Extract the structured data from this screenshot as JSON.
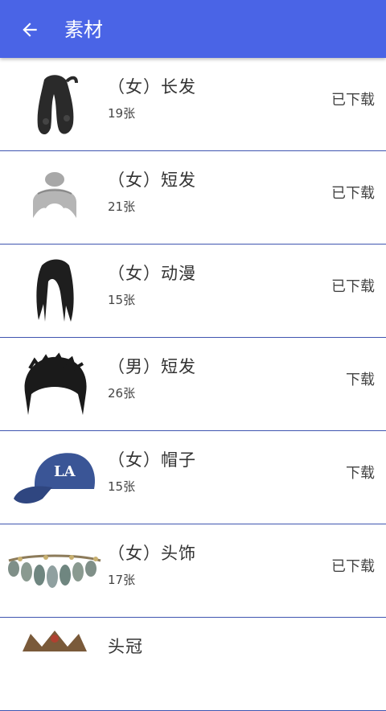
{
  "header": {
    "title": "素材"
  },
  "items": [
    {
      "name": "（女）长发",
      "count": "19张",
      "status": "已下载"
    },
    {
      "name": "（女）短发",
      "count": "21张",
      "status": "已下载"
    },
    {
      "name": "（女）动漫",
      "count": "15张",
      "status": "已下载"
    },
    {
      "name": "（男）短发",
      "count": "26张",
      "status": "下载"
    },
    {
      "name": "（女）帽子",
      "count": "15张",
      "status": "下载"
    },
    {
      "name": "（女）头饰",
      "count": "17张",
      "status": "已下载"
    },
    {
      "name": "头冠",
      "count": "",
      "status": ""
    }
  ]
}
